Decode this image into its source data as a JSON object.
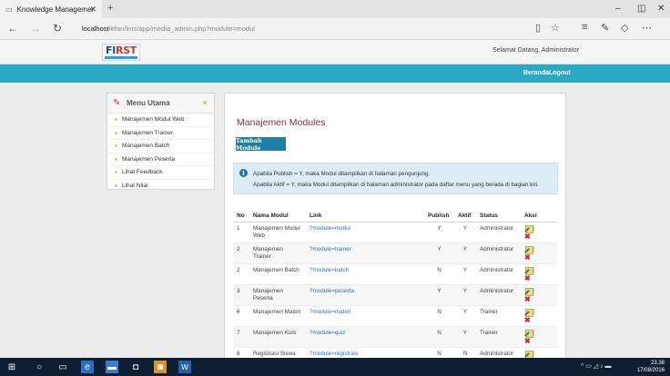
{
  "browser": {
    "tab_title": "Knowledge Managemer",
    "url_domain": "localhost",
    "url_rest": "/efan/lms/app/media_admin.php?module=modul"
  },
  "site": {
    "logo_text_a": "FI",
    "logo_text_b": "RST",
    "greeting": "Selamat Datang, Administrator",
    "nav_beranda": "Beranda",
    "nav_logout": "Logout"
  },
  "sidebar": {
    "title": "Menu Utama",
    "items": [
      {
        "label": "Manajemen Modul Web"
      },
      {
        "label": "Manajemen Trainer"
      },
      {
        "label": "Manajemen Batch"
      },
      {
        "label": "Manajemen Peserta"
      },
      {
        "label": "Lihat Feedback"
      },
      {
        "label": "Lihat Nilai"
      }
    ]
  },
  "main": {
    "title": "Manajemen Modules",
    "add_button": "Tambah Module",
    "info_line1": "Apabila Publish = Y, maka Modul ditampilkan di halaman pengunjung.",
    "info_line2": "Apabila Aktif = Y, maka Modul ditampilkan di halaman administrator pada daftar menu yang berada di bagian kiri."
  },
  "table": {
    "headers": [
      "No",
      "Nama Modul",
      "Link",
      "Publish",
      "Aktif",
      "Status",
      "Aksi"
    ],
    "rows": [
      {
        "no": "1",
        "nama": "Manajemen Modul Web",
        "link": "?module=modul",
        "publish": "Y",
        "aktif": "Y",
        "status": "Administrator"
      },
      {
        "no": "2",
        "nama": "Manajemen Trainer",
        "link": "?module=trainer",
        "publish": "Y",
        "aktif": "Y",
        "status": "Administrator"
      },
      {
        "no": "2",
        "nama": "Manajemen Batch",
        "link": "?module=batch",
        "publish": "N",
        "aktif": "Y",
        "status": "Administrator"
      },
      {
        "no": "3",
        "nama": "Manajemen Peserta",
        "link": "?module=peserta",
        "publish": "Y",
        "aktif": "Y",
        "status": "Administrator"
      },
      {
        "no": "6",
        "nama": "Manajemen Materi",
        "link": "?module=materi",
        "publish": "N",
        "aktif": "Y",
        "status": "Trainer"
      },
      {
        "no": "7",
        "nama": "Manajemen Kuis",
        "link": "?module=quiz",
        "publish": "N",
        "aktif": "Y",
        "status": "Trainer"
      },
      {
        "no": "8",
        "nama": "Registrasi Siswa",
        "link": "?module=registrasi",
        "publish": "N",
        "aktif": "N",
        "status": "Administrator"
      }
    ]
  },
  "taskbar": {
    "time": "23.38",
    "date": "17/08/2016"
  }
}
